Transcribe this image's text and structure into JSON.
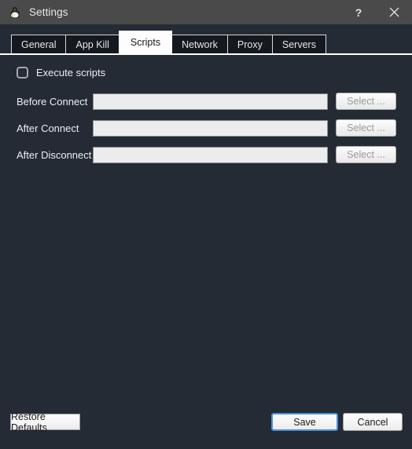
{
  "window": {
    "title": "Settings",
    "icon": "vpn-lock-icon",
    "controls": {
      "help_label": "?",
      "close_label": "close-icon"
    },
    "colors": {
      "titlebar": "#4a4a4a",
      "body": "#252b35",
      "tab_active_bg": "#fdfdfd",
      "tab_inactive_bg": "#15181e",
      "accent_focus": "#4a90d9",
      "input_bg": "#ececec"
    }
  },
  "tabs": [
    {
      "label": "General",
      "active": false
    },
    {
      "label": "App Kill",
      "active": false
    },
    {
      "label": "Scripts",
      "active": true
    },
    {
      "label": "Network",
      "active": false
    },
    {
      "label": "Proxy",
      "active": false
    },
    {
      "label": "Servers",
      "active": false
    }
  ],
  "scripts_panel": {
    "execute_scripts": {
      "label": "Execute scripts",
      "checked": false
    },
    "rows": [
      {
        "label": "Before Connect",
        "value": "",
        "placeholder": "",
        "button_label": "Select ...",
        "disabled": true
      },
      {
        "label": "After Connect",
        "value": "",
        "placeholder": "",
        "button_label": "Select ...",
        "disabled": true
      },
      {
        "label": "After Disconnect",
        "value": "",
        "placeholder": "",
        "button_label": "Select ...",
        "disabled": true
      }
    ]
  },
  "footer": {
    "restore_label": "Restore Defaults",
    "save_label": "Save",
    "cancel_label": "Cancel"
  }
}
